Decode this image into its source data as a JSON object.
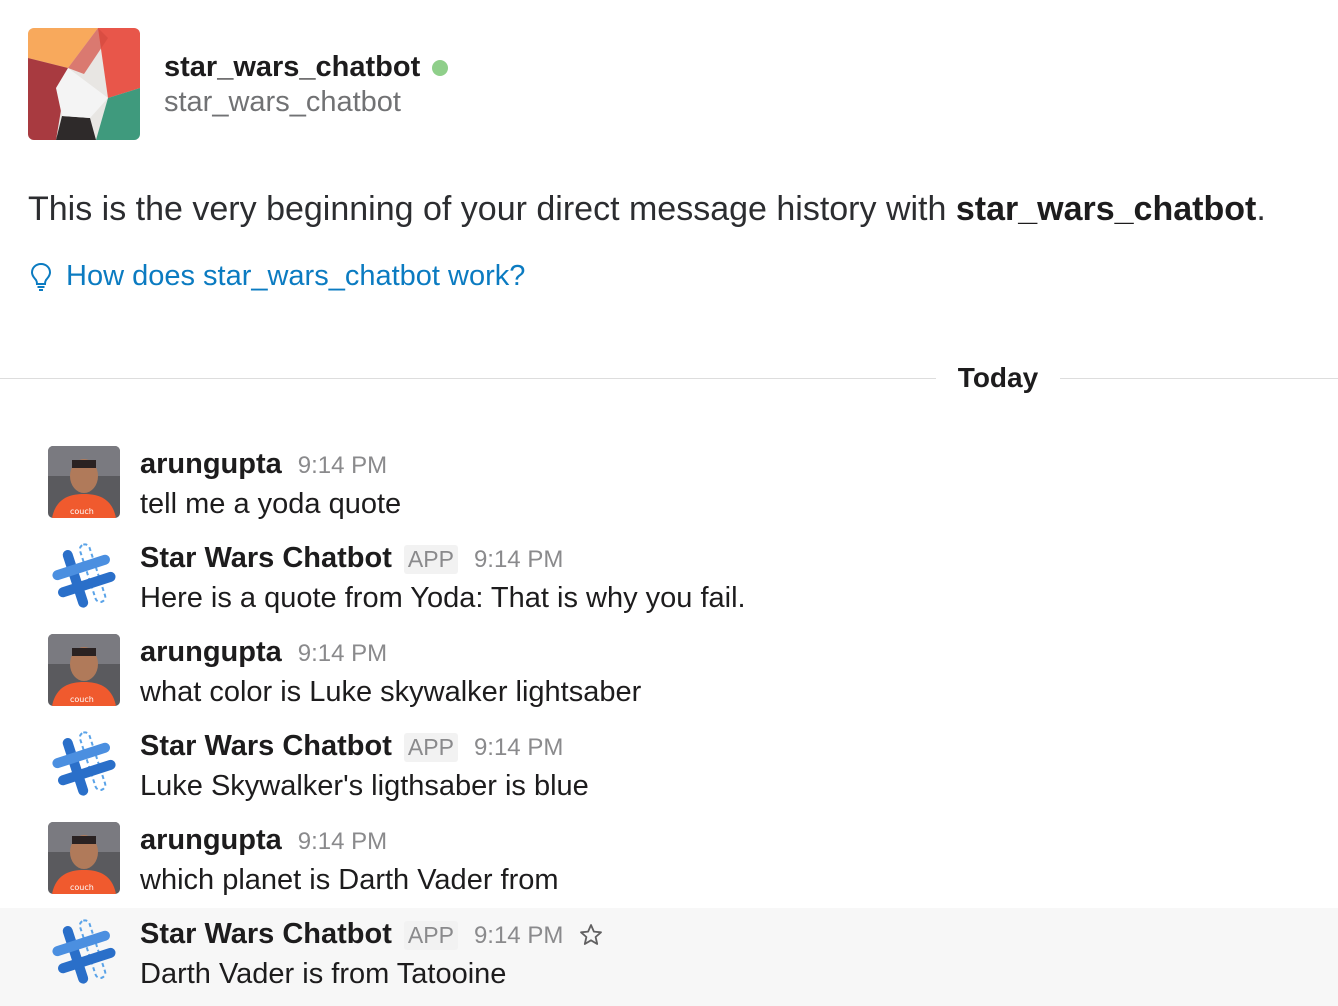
{
  "header": {
    "name": "star_wars_chatbot",
    "handle": "star_wars_chatbot",
    "presence_color": "#8fcf8a"
  },
  "intro": {
    "text": "This is the very beginning of your direct message history with ",
    "bold_name": "star_wars_chatbot",
    "period": "."
  },
  "howto": {
    "icon": "lightbulb-icon",
    "label": "How does star_wars_chatbot work?"
  },
  "divider": {
    "label": "Today"
  },
  "messages": [
    {
      "sender": "arungupta",
      "is_app": false,
      "badge": "",
      "time": "9:14 PM",
      "text": "tell me a yoda quote"
    },
    {
      "sender": "Star Wars Chatbot",
      "is_app": true,
      "badge": "APP",
      "time": "9:14 PM",
      "text": "Here is a quote from Yoda: That is why you fail."
    },
    {
      "sender": "arungupta",
      "is_app": false,
      "badge": "",
      "time": "9:14 PM",
      "text": "what color is Luke skywalker lightsaber"
    },
    {
      "sender": "Star Wars Chatbot",
      "is_app": true,
      "badge": "APP",
      "time": "9:14 PM",
      "text": "Luke Skywalker's ligthsaber is blue"
    },
    {
      "sender": "arungupta",
      "is_app": false,
      "badge": "",
      "time": "9:14 PM",
      "text": "which planet is Darth Vader from"
    },
    {
      "sender": "Star Wars Chatbot",
      "is_app": true,
      "badge": "APP",
      "time": "9:14 PM",
      "text": "Darth Vader is from Tatooine"
    }
  ],
  "colors": {
    "link": "#0b7bc1",
    "hover_row": "#f7f7f7",
    "muted": "#8a8a8c"
  }
}
